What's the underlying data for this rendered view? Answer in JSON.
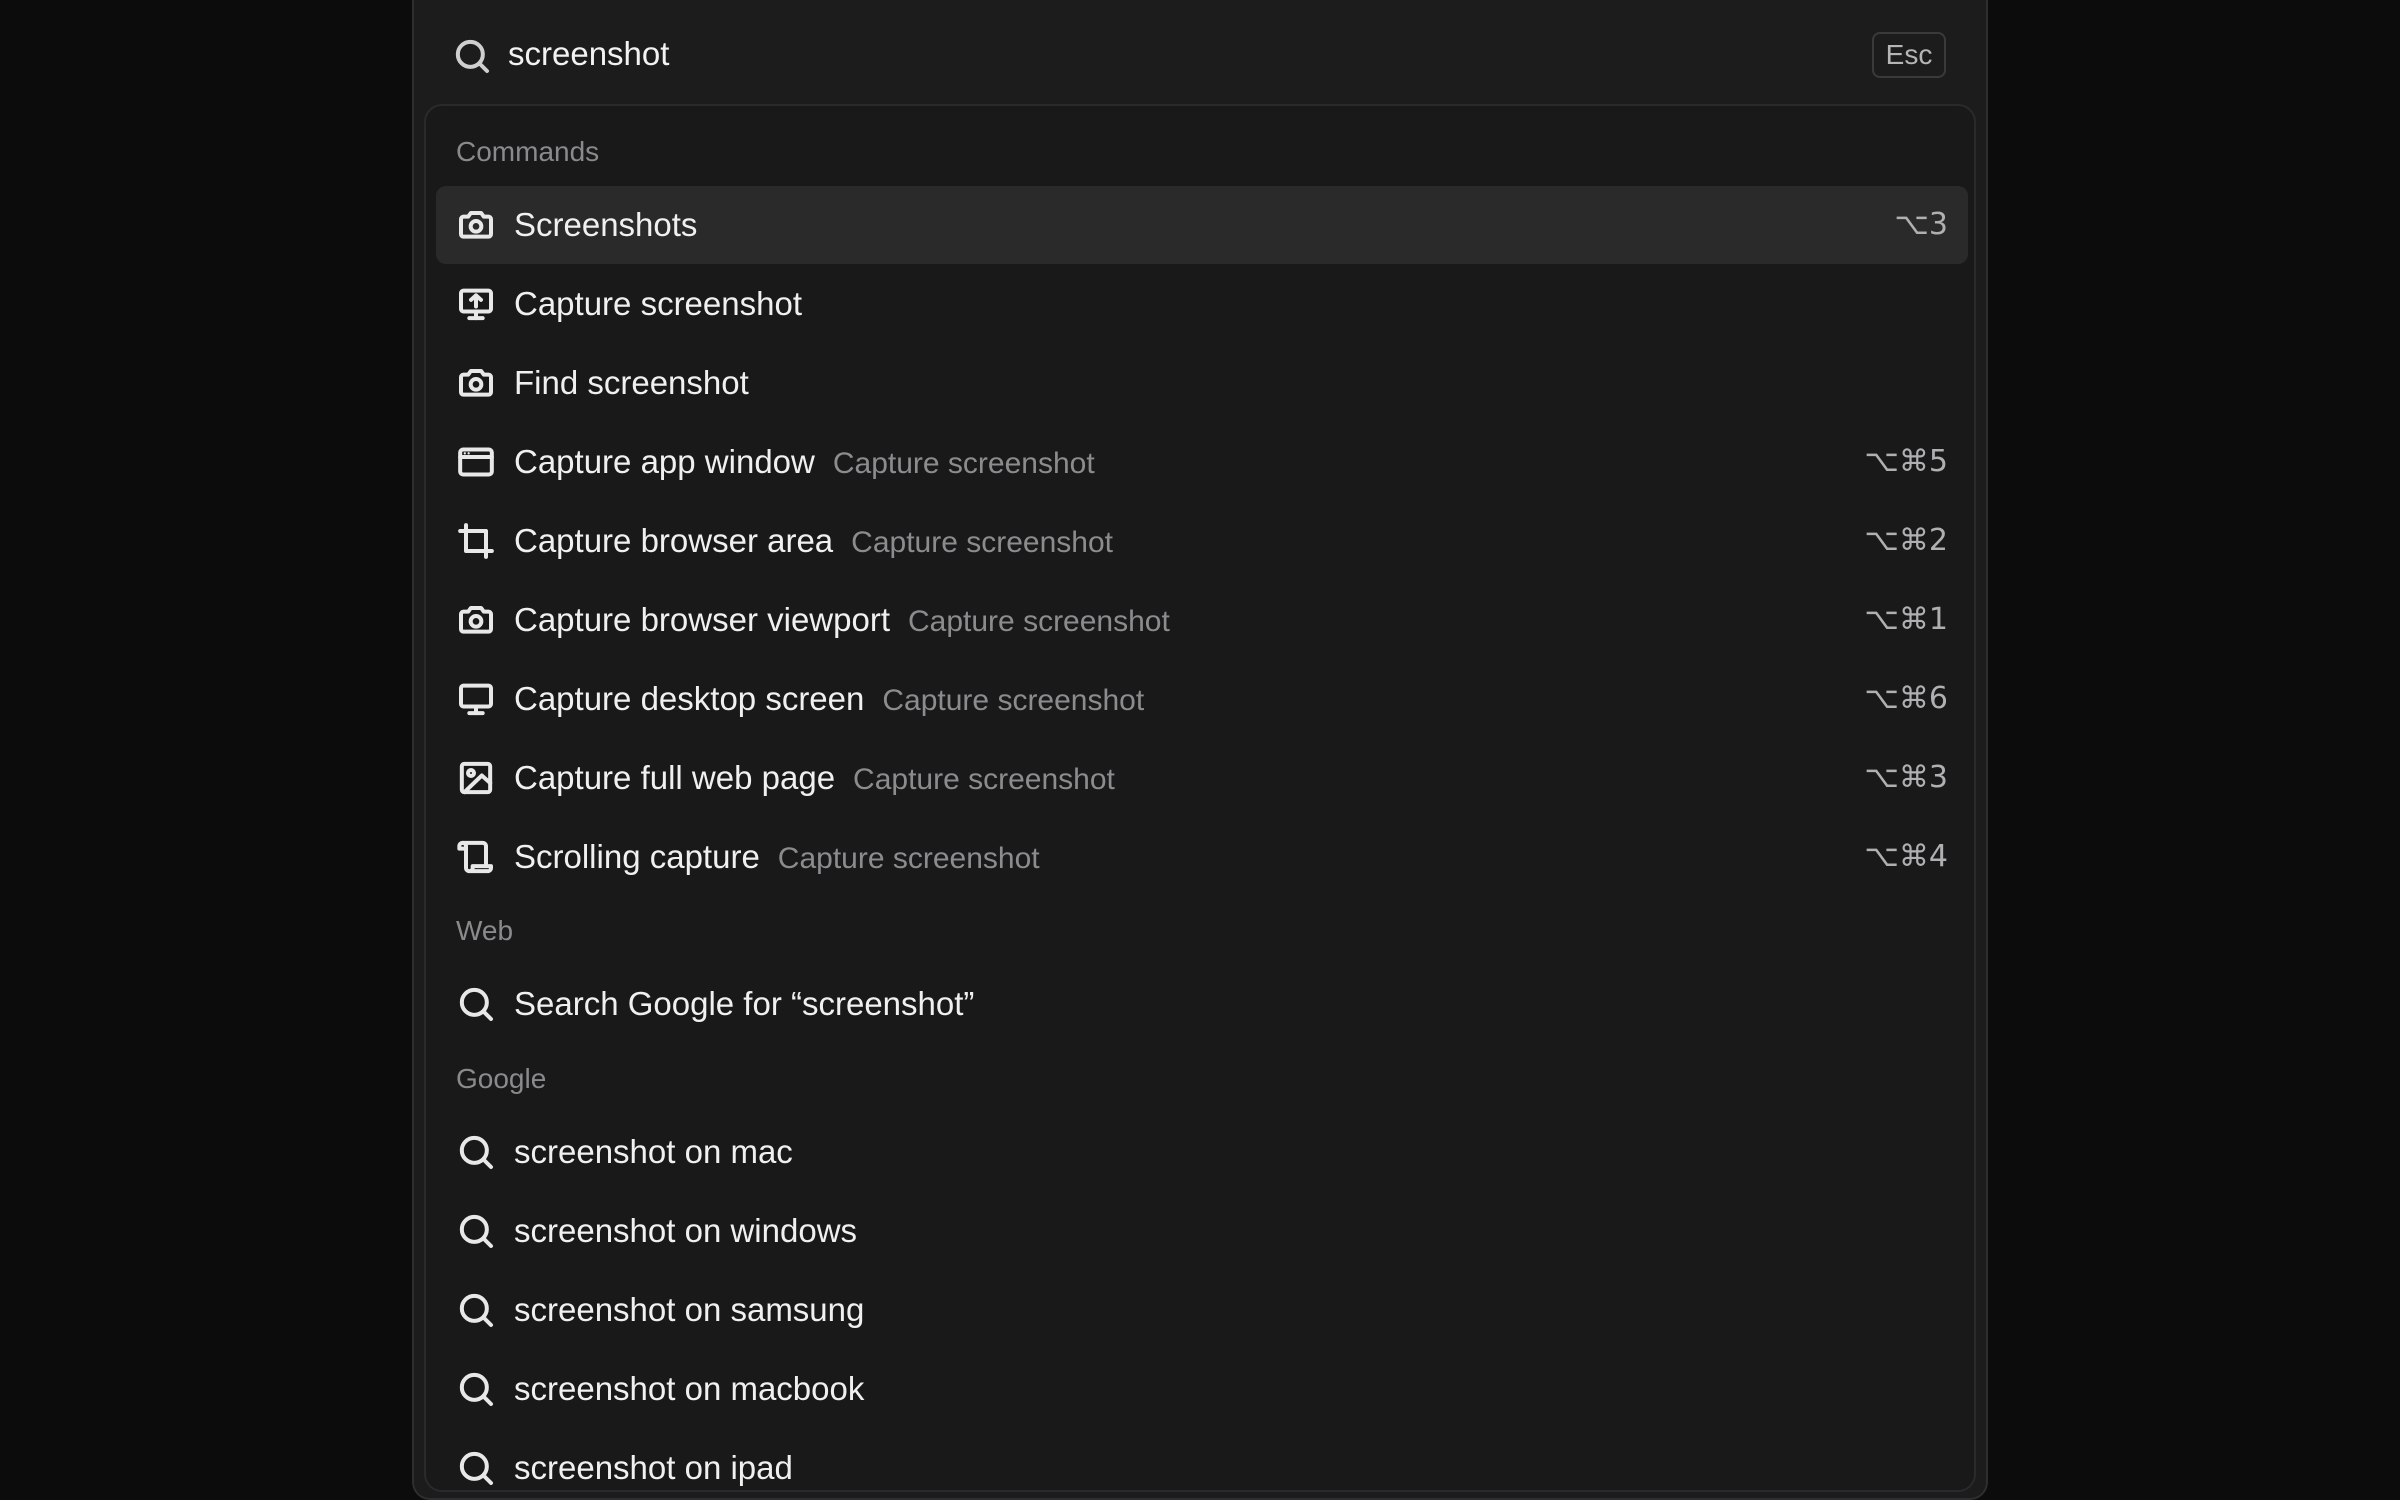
{
  "search": {
    "value": "screenshot",
    "esc_label": "Esc"
  },
  "sections": {
    "commands": "Commands",
    "web": "Web",
    "google": "Google"
  },
  "commands": [
    {
      "label": "Screenshots",
      "sub": "",
      "shortcut": "⌥3",
      "icon": "camera-icon",
      "selected": true
    },
    {
      "label": "Capture screenshot",
      "sub": "",
      "shortcut": "",
      "icon": "monitor-upload-icon"
    },
    {
      "label": "Find screenshot",
      "sub": "",
      "shortcut": "",
      "icon": "camera-icon"
    },
    {
      "label": "Capture app window",
      "sub": "Capture screenshot",
      "shortcut": "⌥⌘5",
      "icon": "app-window-icon"
    },
    {
      "label": "Capture browser area",
      "sub": "Capture screenshot",
      "shortcut": "⌥⌘2",
      "icon": "crop-icon"
    },
    {
      "label": "Capture browser viewport",
      "sub": "Capture screenshot",
      "shortcut": "⌥⌘1",
      "icon": "camera-icon"
    },
    {
      "label": "Capture desktop screen",
      "sub": "Capture screenshot",
      "shortcut": "⌥⌘6",
      "icon": "monitor-icon"
    },
    {
      "label": "Capture full web page",
      "sub": "Capture screenshot",
      "shortcut": "⌥⌘3",
      "icon": "image-icon"
    },
    {
      "label": "Scrolling capture",
      "sub": "Capture screenshot",
      "shortcut": "⌥⌘4",
      "icon": "scroll-icon"
    }
  ],
  "web": [
    {
      "label": "Search Google for “screenshot”",
      "icon": "search-icon"
    }
  ],
  "google": [
    {
      "label": "screenshot on mac",
      "icon": "search-icon"
    },
    {
      "label": "screenshot on windows",
      "icon": "search-icon"
    },
    {
      "label": "screenshot on samsung",
      "icon": "search-icon"
    },
    {
      "label": "screenshot on macbook",
      "icon": "search-icon"
    },
    {
      "label": "screenshot on ipad",
      "icon": "search-icon"
    }
  ]
}
